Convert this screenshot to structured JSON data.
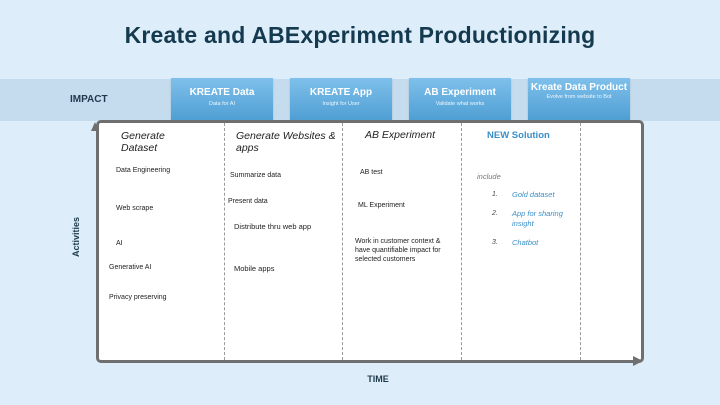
{
  "title": "Kreate and ABExperiment Productionizing",
  "impact_label": "IMPACT",
  "activities_label": "Activities",
  "time_label": "TIME",
  "headers": [
    {
      "title": "KREATE Data",
      "subtitle": "Data for AI"
    },
    {
      "title": "KREATE App",
      "subtitle": "Insight for User"
    },
    {
      "title": "AB Experiment",
      "subtitle": "Validate what works"
    },
    {
      "title": "Kreate Data Product",
      "subtitle": "Evolve from website to Bot"
    }
  ],
  "columns": [
    {
      "heading": "Generate Dataset",
      "items": [
        "Data Engineering",
        "Web scrape",
        "AI",
        "Generative AI",
        "Privacy preserving"
      ]
    },
    {
      "heading": "Generate Websites & apps",
      "items": [
        "Summarize data",
        "Present data",
        "Distribute thru web app",
        "Mobile apps"
      ]
    },
    {
      "heading": "AB Experiment",
      "items": [
        "AB test",
        "ML Experiment",
        "Work in customer context & have quantifiable impact for selected customers"
      ]
    },
    {
      "heading": "NEW Solution",
      "include": "include",
      "items": [
        {
          "num": "1.",
          "text": "Gold dataset"
        },
        {
          "num": "2.",
          "text": "App for sharing insight"
        },
        {
          "num": "3.",
          "text": "Chatbot"
        }
      ]
    }
  ]
}
